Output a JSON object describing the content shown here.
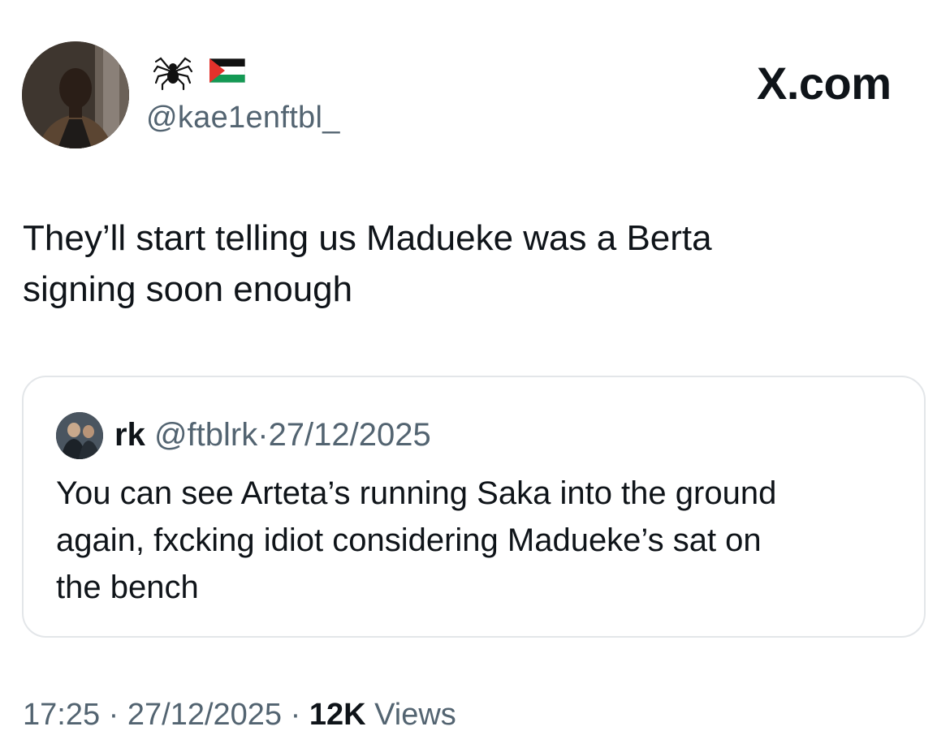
{
  "author": {
    "display_name_icons": [
      "spider-emoji",
      "palestine-flag-emoji"
    ],
    "handle": "@kae1enftbl_"
  },
  "watermark": "X.com",
  "tweet": {
    "text_line_1": "They’ll start telling us Madueke was a Berta",
    "text_line_2": "signing soon enough"
  },
  "quoted_tweet": {
    "name": "rk",
    "handle": "@ftblrk",
    "separator": "·",
    "date": "27/12/2025",
    "text_line_1": "You can see Arteta’s running Saka into the ground",
    "text_line_2": "again, fxcking idiot considering Madueke’s sat on",
    "text_line_3": "the bench"
  },
  "footer": {
    "time": "17:25",
    "sep1": "·",
    "date": "27/12/2025",
    "sep2": "·",
    "views_count": "12K",
    "views_label": "Views"
  },
  "colors": {
    "text_primary": "#0f1419",
    "text_secondary": "#536471",
    "border": "#e3e6e9",
    "flag_red": "#e4312b",
    "flag_green": "#149954"
  }
}
